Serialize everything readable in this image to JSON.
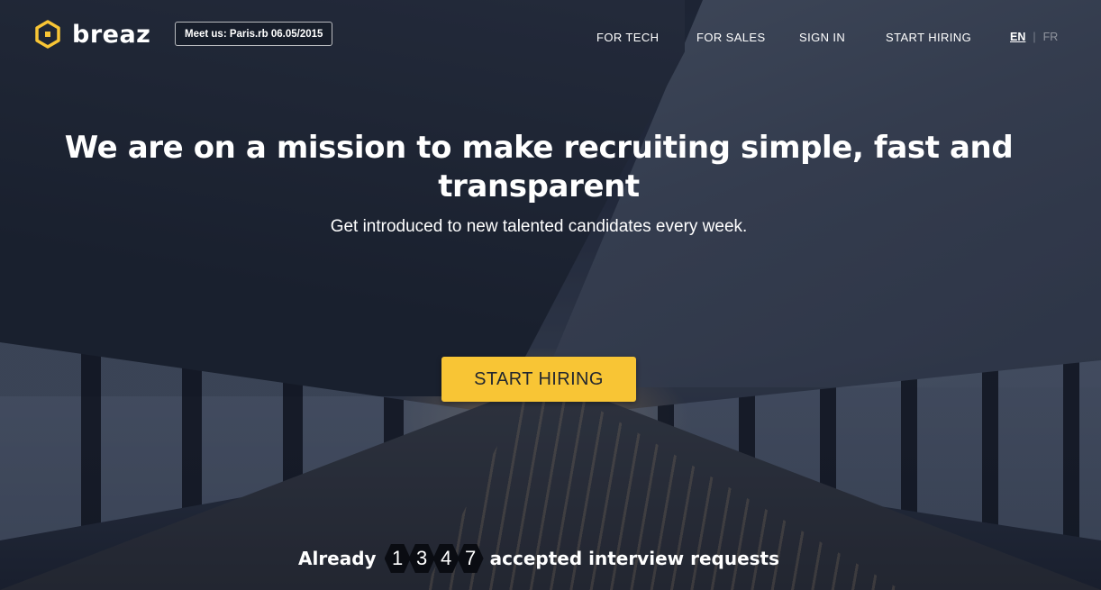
{
  "brand": {
    "name": "breaz",
    "accent": "#f8c535"
  },
  "meetup": {
    "label": "Meet us: Paris.rb 06.05/2015"
  },
  "nav": {
    "items": [
      {
        "label": "FOR TECH"
      },
      {
        "label": "FOR SALES"
      },
      {
        "label": "SIGN IN"
      },
      {
        "label": "START HIRING"
      }
    ],
    "languages": {
      "active": "EN",
      "separator": "|",
      "other": "FR"
    }
  },
  "hero": {
    "headline_line1": "We are on a mission to make recruiting simple, fast and",
    "headline_line2": "transparent",
    "subline": "Get introduced to new talented candidates every week.",
    "cta_label": "START HIRING"
  },
  "counter": {
    "prefix": "Already",
    "digits": [
      "1",
      "3",
      "4",
      "7"
    ],
    "suffix": "accepted interview requests"
  },
  "icons": {
    "logo": "hexagon-logo-icon"
  }
}
